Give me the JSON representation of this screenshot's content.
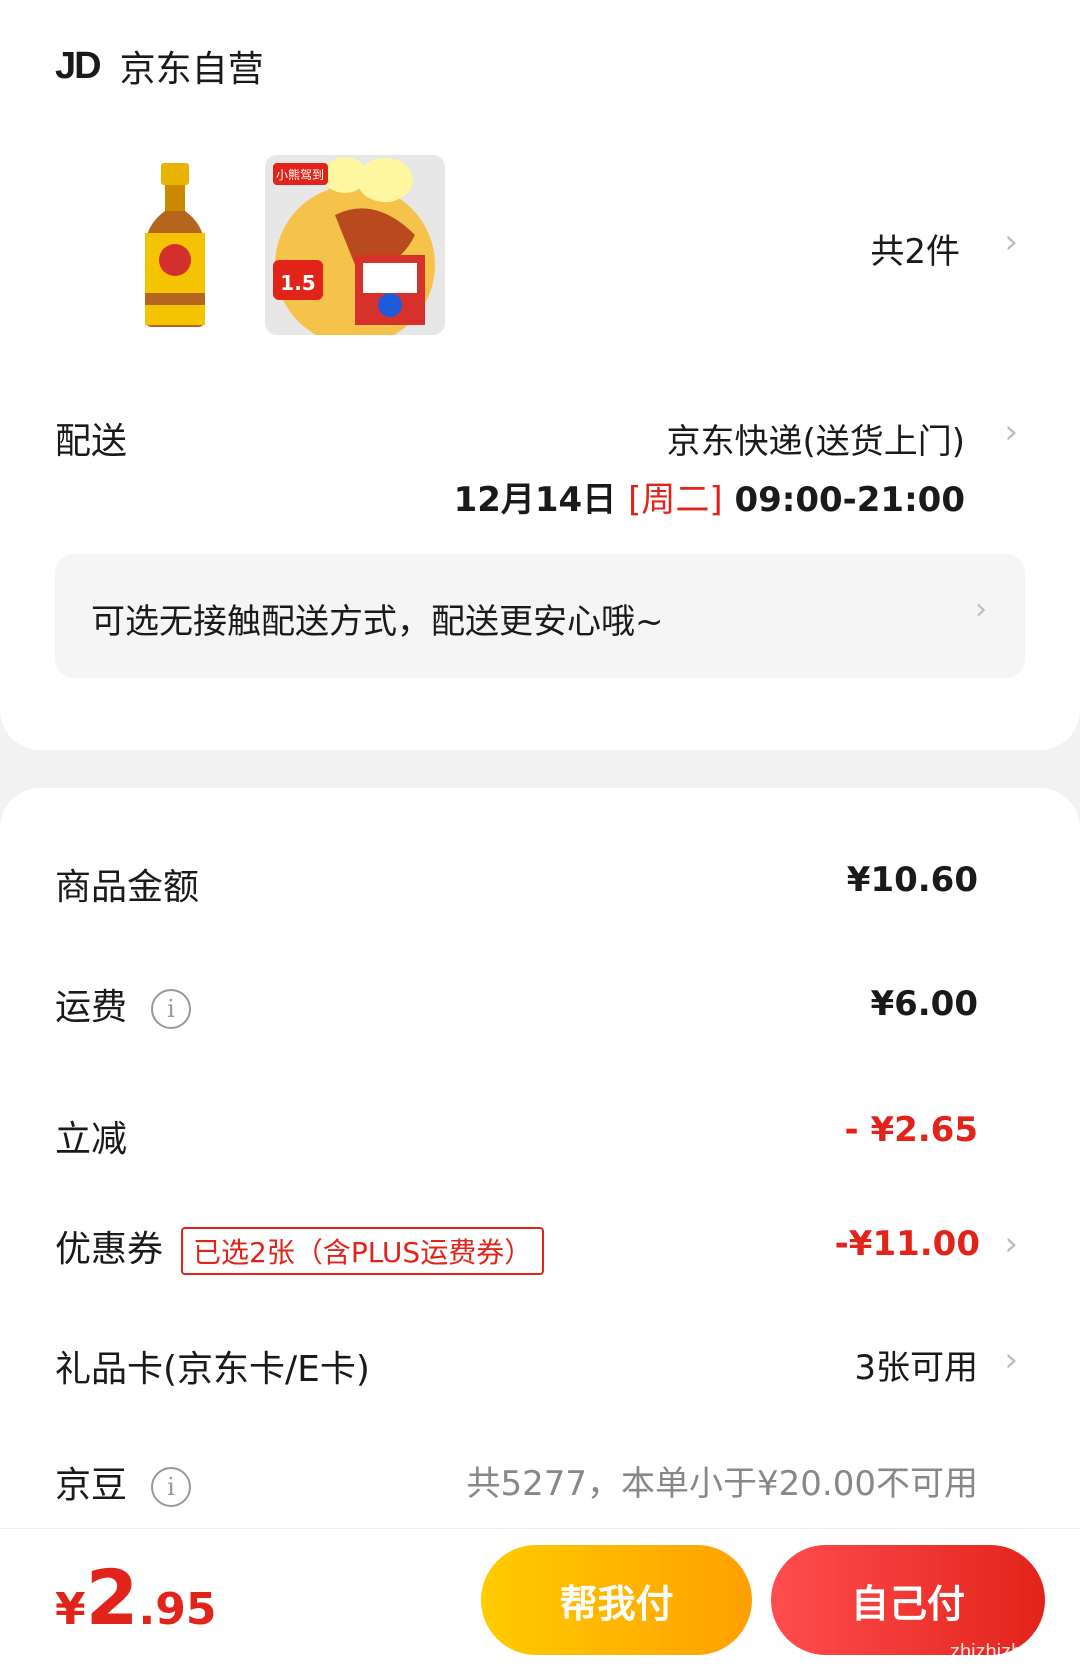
{
  "shop": {
    "logo": "JD",
    "name": "京东自营"
  },
  "goods": {
    "count_label": "共2件"
  },
  "product2": {
    "top_label": "小熊驾到",
    "price": "1.5"
  },
  "delivery": {
    "label": "配送",
    "method": "京东快递(送货上门)",
    "date": "12月14日",
    "weekday": "[周二]",
    "time_range": "09:00-21:00",
    "notice": "可选无接触配送方式，配送更安心哦~"
  },
  "summary": {
    "goods_amount": {
      "label": "商品金额",
      "value": "¥10.60"
    },
    "shipping": {
      "label": "运费",
      "value": "¥6.00"
    },
    "discount": {
      "label": "立减",
      "value": "- ¥2.65"
    },
    "coupon": {
      "label": "优惠券",
      "tag": "已选2张（含PLUS运费券）",
      "value": "-¥11.00"
    },
    "gift_card": {
      "label": "礼品卡(京东卡/E卡)",
      "value": "3张可用"
    },
    "jingdou": {
      "label": "京豆",
      "value": "共5277，本单小于¥20.00不可用"
    }
  },
  "footer": {
    "total_yen": "¥",
    "total_int": "2",
    "total_dec": ".95",
    "help_pay_label": "帮我付",
    "self_pay_label": "自己付",
    "watermark": "zhizhizhi.com"
  },
  "colors": {
    "accent_red": "#e2231a",
    "help_button": "#ffb300",
    "self_button": "#ff3b30"
  },
  "icons": [
    "chevron-right-icon",
    "info-icon"
  ]
}
